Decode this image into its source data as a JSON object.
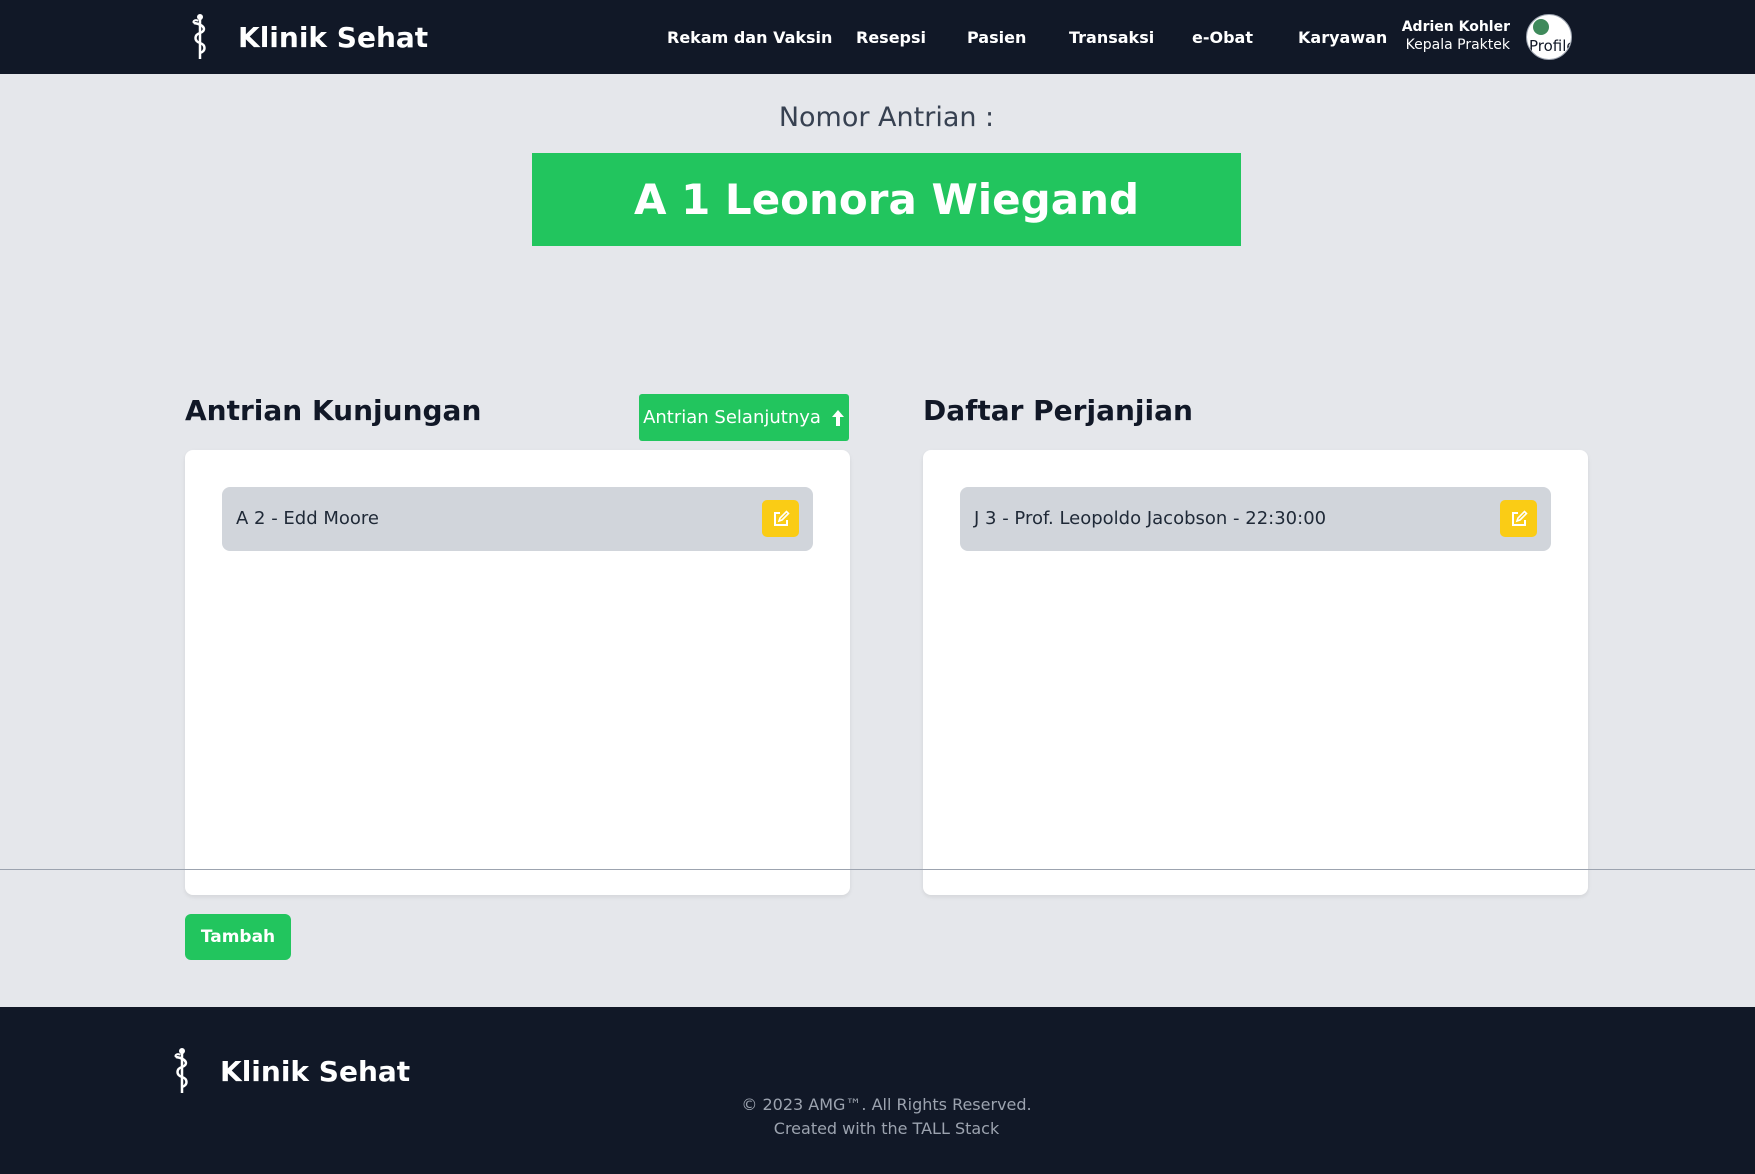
{
  "header": {
    "brand": "Klinik Sehat",
    "nav": [
      {
        "label": "Rekam dan Vaksin"
      },
      {
        "label": "Resepsi"
      },
      {
        "label": "Pasien"
      },
      {
        "label": "Transaksi"
      },
      {
        "label": "e-Obat"
      },
      {
        "label": "Karyawan"
      }
    ],
    "user": {
      "name": "Adrien Kohler",
      "role": "Kepala Praktek",
      "avatar_alt": "Profile"
    }
  },
  "current_queue": {
    "label": "Nomor Antrian :",
    "value": "A 1 Leonora Wiegand"
  },
  "visits": {
    "title": "Antrian Kunjungan",
    "next_button": "Antrian Selanjutnya",
    "items": [
      {
        "text": "A 2 - Edd Moore"
      }
    ]
  },
  "appointments": {
    "title": "Daftar Perjanjian",
    "items": [
      {
        "text": "J 3 - Prof. Leopoldo Jacobson - 22:30:00"
      }
    ]
  },
  "actions": {
    "add_button": "Tambah"
  },
  "footer": {
    "brand": "Klinik Sehat",
    "copyright": "© 2023 AMG™. All Rights Reserved.",
    "credit": "Created with the TALL Stack"
  },
  "colors": {
    "nav_bg": "#111827",
    "page_bg": "#e5e7eb",
    "accent_green": "#22c55e",
    "edit_yellow": "#facc15"
  },
  "icons": {
    "logo": "caduceus-icon",
    "next": "arrow-up-icon",
    "edit": "edit-icon"
  }
}
